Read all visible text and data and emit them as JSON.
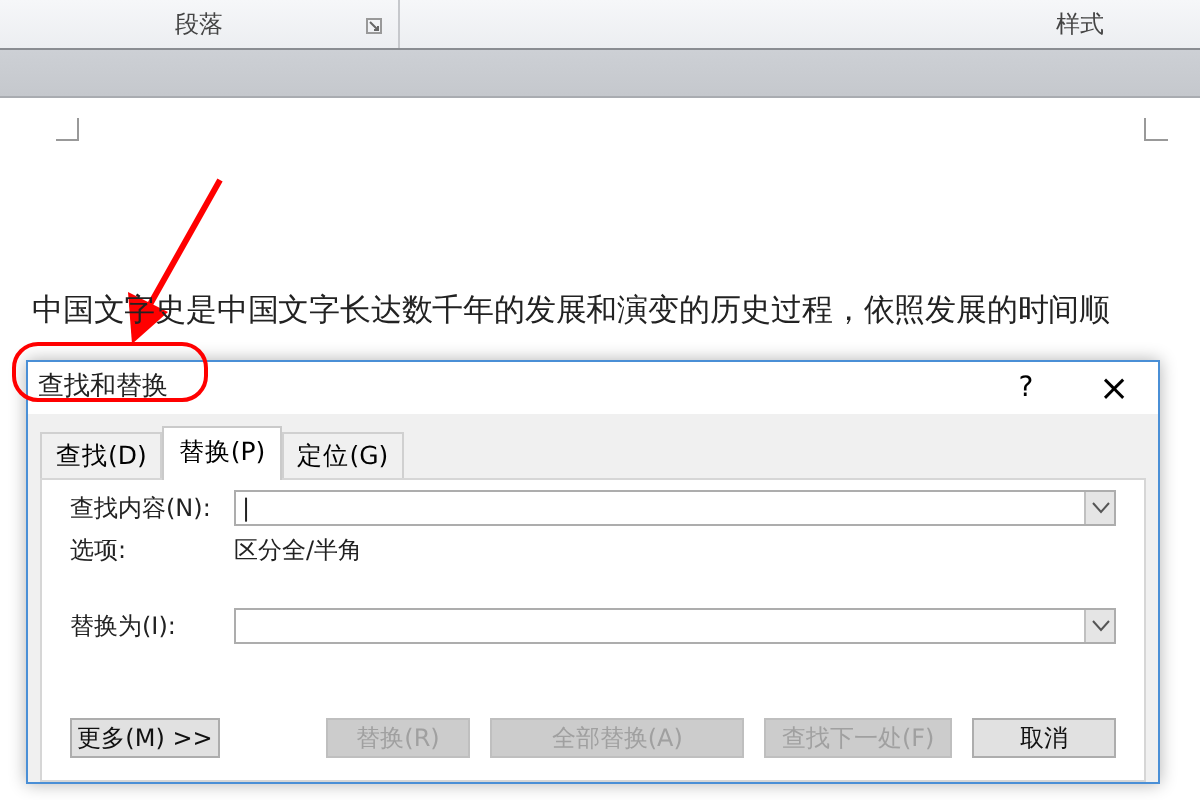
{
  "ribbon": {
    "groups": [
      {
        "label": "段落",
        "launcher": true
      },
      {
        "label": "样式",
        "launcher": false
      }
    ]
  },
  "document": {
    "lines": [
      "中国文字史是中国文字长达数千年的发展和演变的历史过程，依照发展的时间顺"
    ]
  },
  "dialog": {
    "title": "查找和替换",
    "help": "?",
    "close": "×",
    "tabs": [
      {
        "label": "查找(D)",
        "selected": false
      },
      {
        "label": "替换(P)",
        "selected": true
      },
      {
        "label": "定位(G)",
        "selected": false
      }
    ],
    "find": {
      "label": "查找内容(N):",
      "value": "|"
    },
    "options": {
      "label": "选项:",
      "value": "区分全/半角"
    },
    "replace": {
      "label": "替换为(I):"
    },
    "buttons": [
      {
        "label": "更多(M) >>",
        "disabled": false
      },
      {
        "label": "替换(R)",
        "disabled": true
      },
      {
        "label": "全部替换(A)",
        "disabled": true
      },
      {
        "label": "查找下一处(F)",
        "disabled": true
      },
      {
        "label": "取消",
        "disabled": false
      }
    ]
  }
}
